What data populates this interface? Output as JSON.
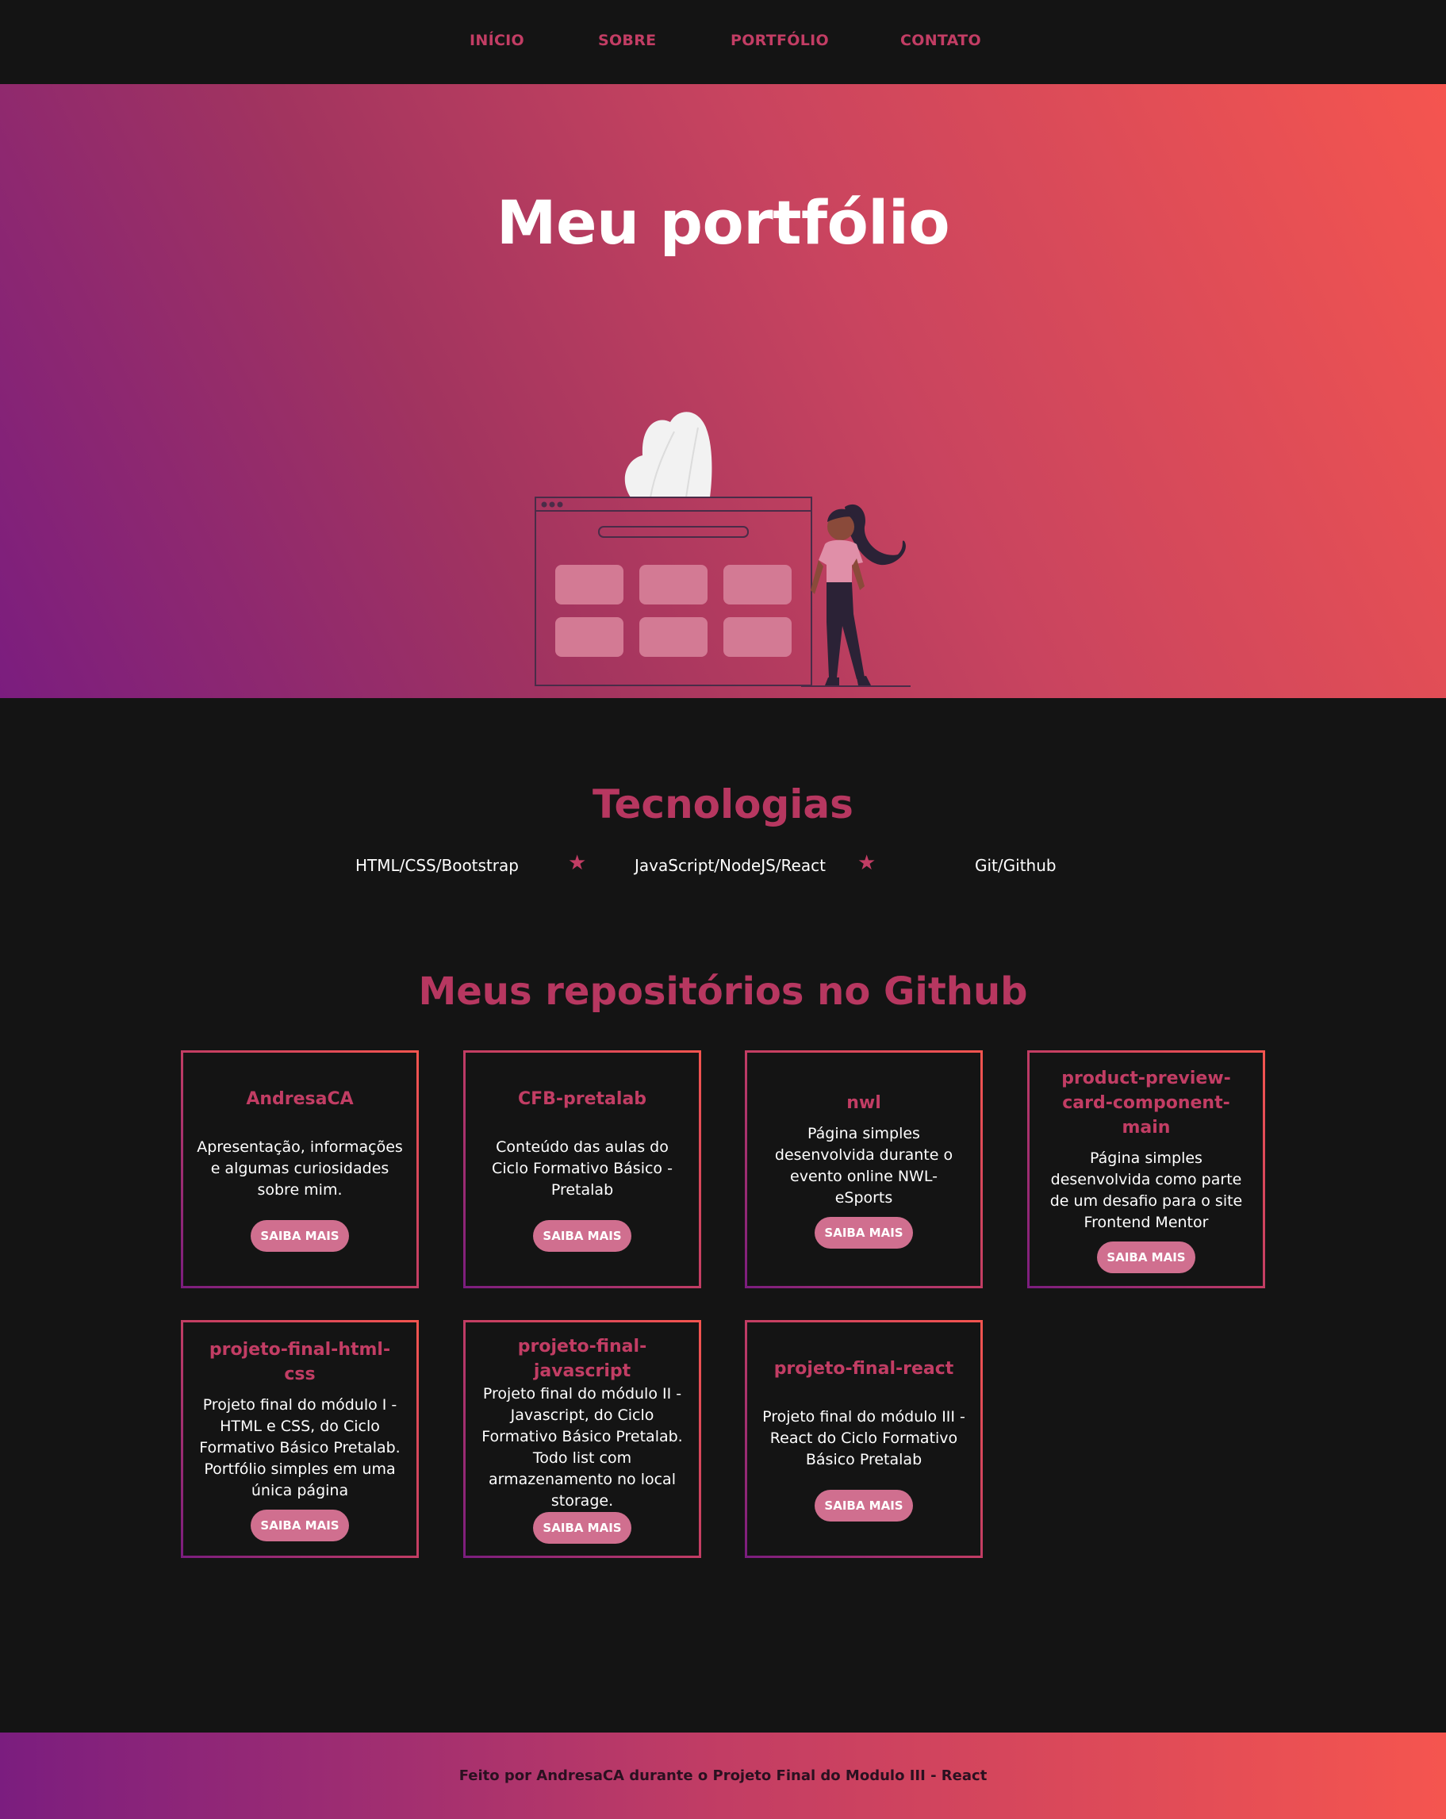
{
  "nav": {
    "items": [
      {
        "label": "INÍCIO"
      },
      {
        "label": "SOBRE"
      },
      {
        "label": "PORTFÓLIO"
      },
      {
        "label": "CONTATO"
      }
    ]
  },
  "hero": {
    "title": "Meu portfólio"
  },
  "tech": {
    "title": "Tecnologias",
    "items": [
      "HTML/CSS/Bootstrap",
      "JavaScript/NodeJS/React",
      "Git/Github"
    ],
    "separator": "★"
  },
  "repos": {
    "title": "Meus repositórios no Github",
    "button_label": "SAIBA MAIS",
    "cards": [
      {
        "title": "AndresaCA",
        "description": "Apresentação, informações e algumas curiosidades sobre mim."
      },
      {
        "title": "CFB-pretalab",
        "description": "Conteúdo das aulas do Ciclo Formativo Básico - Pretalab"
      },
      {
        "title": "nwl",
        "description": "Página simples desenvolvida durante o evento online NWL-eSports"
      },
      {
        "title": "product-preview-card-component-main",
        "description": "Página simples desenvolvida como parte de um desafio para o site Frontend Mentor"
      },
      {
        "title": "projeto-final-html-css",
        "description": "Projeto final do módulo I - HTML e CSS, do Ciclo Formativo Básico Pretalab. Portfólio simples em uma única página"
      },
      {
        "title": "projeto-final-javascript",
        "description": "Projeto final do módulo II - Javascript, do Ciclo Formativo Básico Pretalab. Todo list com armazenamento no local storage."
      },
      {
        "title": "projeto-final-react",
        "description": "Projeto final do módulo III - React do Ciclo Formativo Básico Pretalab"
      }
    ]
  },
  "footer": {
    "text": "Feito por AndresaCA durante o Projeto Final do Modulo III - React"
  },
  "colors": {
    "accent": "#c23d64",
    "button": "#d06f8f",
    "background": "#141414",
    "gradient_start": "#7b1d7f",
    "gradient_end": "#f5554f"
  }
}
